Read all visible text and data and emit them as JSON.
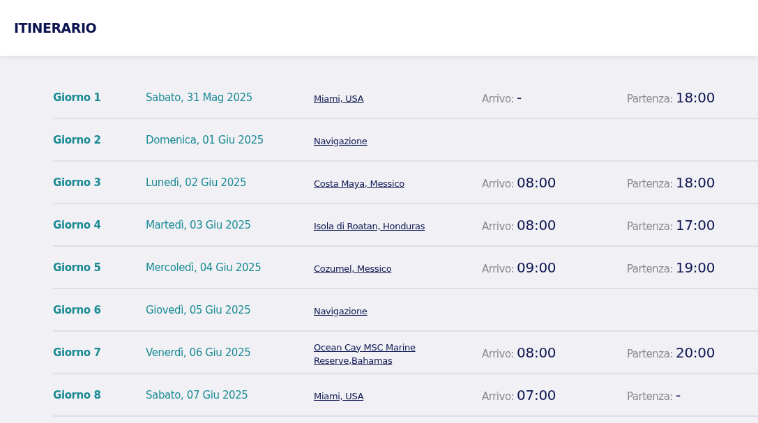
{
  "header": {
    "title": "ITINERARIO"
  },
  "days": [
    {
      "day": "Giorno 1",
      "date": "Sabato, 31 Mag 2025",
      "port": "Miami, USA",
      "arrival": {
        "label": "Arrivo:",
        "value": "-"
      },
      "departure": {
        "label": "Partenza:",
        "value": "18:00"
      }
    },
    {
      "day": "Giorno 2",
      "date": "Domenica, 01 Giu 2025",
      "port": "Navigazione"
    },
    {
      "day": "Giorno 3",
      "date": "Lunedì, 02 Giu 2025",
      "port": "Costa Maya, Messico",
      "arrival": {
        "label": "Arrivo:",
        "value": "08:00"
      },
      "departure": {
        "label": "Partenza:",
        "value": "18:00"
      }
    },
    {
      "day": "Giorno 4",
      "date": "Martedì, 03 Giu 2025",
      "port": "Isola di Roatan, Honduras",
      "arrival": {
        "label": "Arrivo:",
        "value": "08:00"
      },
      "departure": {
        "label": "Partenza:",
        "value": "17:00"
      }
    },
    {
      "day": "Giorno 5",
      "date": "Mercoledì, 04 Giu 2025",
      "port": "Cozumel, Messico",
      "arrival": {
        "label": "Arrivo:",
        "value": "09:00"
      },
      "departure": {
        "label": "Partenza:",
        "value": "19:00"
      }
    },
    {
      "day": "Giorno 6",
      "date": "Giovedì, 05 Giu 2025",
      "port": "Navigazione"
    },
    {
      "day": "Giorno 7",
      "date": "Venerdì, 06 Giu 2025",
      "port": "Ocean Cay MSC Marine Reserve,Bahamas",
      "arrival": {
        "label": "Arrivo:",
        "value": "08:00"
      },
      "departure": {
        "label": "Partenza:",
        "value": "20:00"
      }
    },
    {
      "day": "Giorno 8",
      "date": "Sabato, 07 Giu 2025",
      "port": "Miami, USA",
      "arrival": {
        "label": "Arrivo:",
        "value": "07:00"
      },
      "departure": {
        "label": "Partenza:",
        "value": "-"
      }
    }
  ]
}
